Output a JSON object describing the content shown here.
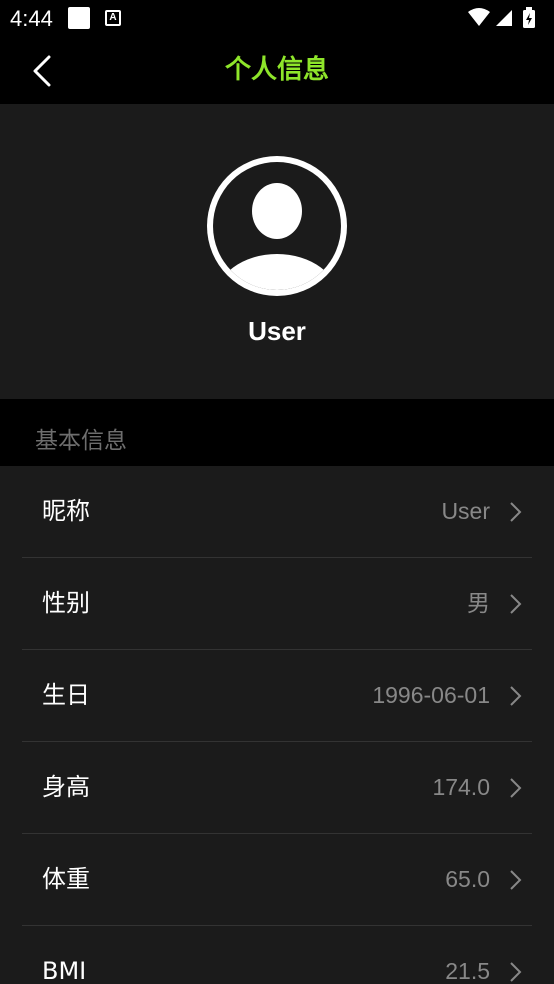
{
  "status_bar": {
    "time": "4:44",
    "notification_letter": "A"
  },
  "header": {
    "title": "个人信息"
  },
  "profile": {
    "username": "User"
  },
  "section": {
    "title": "基本信息"
  },
  "fields": [
    {
      "label": "昵称",
      "value": "User"
    },
    {
      "label": "性别",
      "value": "男"
    },
    {
      "label": "生日",
      "value": "1996-06-01"
    },
    {
      "label": "身高",
      "value": "174.0"
    },
    {
      "label": "体重",
      "value": "65.0"
    },
    {
      "label": "BMI",
      "value": "21.5"
    }
  ],
  "colors": {
    "accent": "#8ee52a",
    "panel": "#1b1b1b",
    "background": "#000000",
    "value_text": "#888888"
  }
}
